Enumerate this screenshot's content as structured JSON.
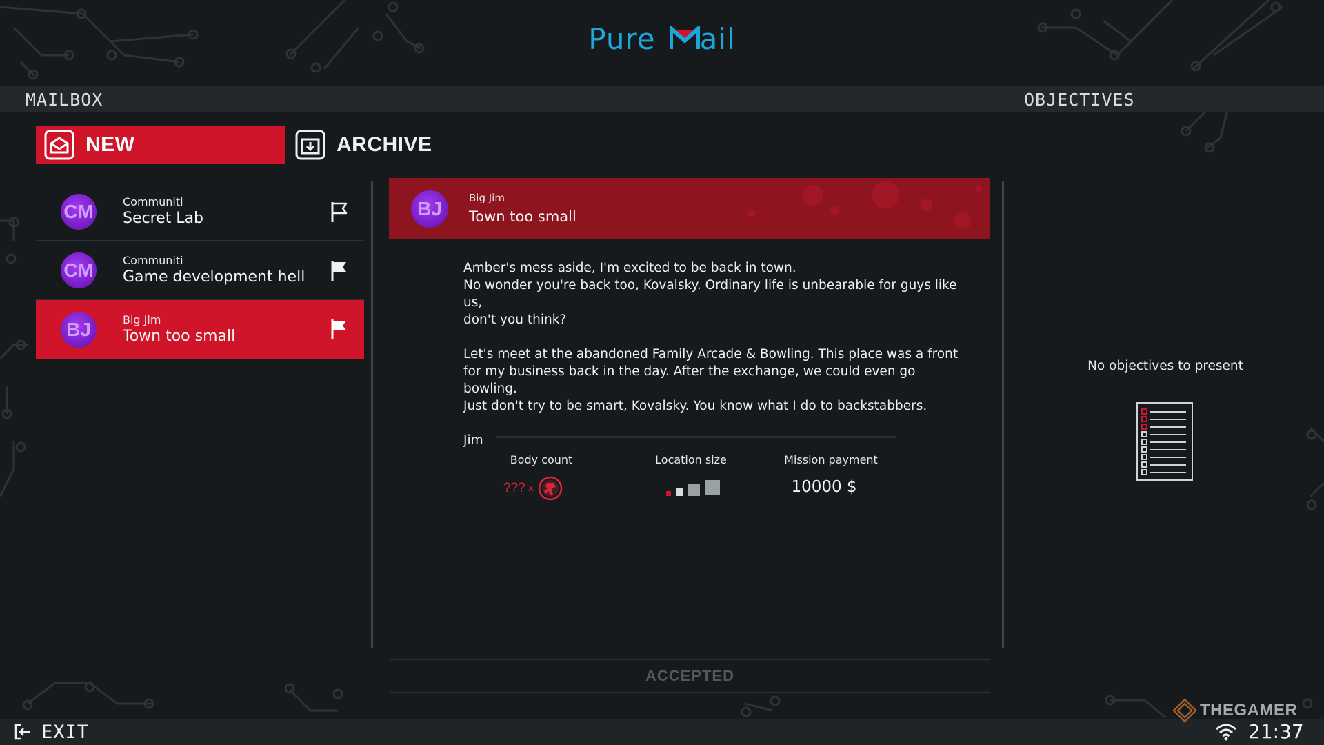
{
  "app": {
    "logo_part1": "Pure",
    "logo_part2": "ail"
  },
  "topbar": {
    "mailbox_label": "MAILBOX",
    "objectives_label": "OBJECTIVES"
  },
  "tabs": {
    "new_label": "NEW",
    "archive_label": "ARCHIVE"
  },
  "mails": [
    {
      "initials": "CM",
      "sender": "Communiti",
      "subject": "Secret Lab",
      "flag": "outline"
    },
    {
      "initials": "CM",
      "sender": "Communiti",
      "subject": "Game development hell",
      "flag": "filled"
    },
    {
      "initials": "BJ",
      "sender": "Big Jim",
      "subject": "Town too small",
      "flag": "filled",
      "selected": true
    }
  ],
  "message": {
    "initials": "BJ",
    "sender": "Big Jim",
    "subject": "Town too small",
    "paragraph1_line1": "Amber's mess aside, I'm excited to be back in town.",
    "paragraph1_line2": "No wonder you're back too, Kovalsky. Ordinary life is unbearable for guys like us,",
    "paragraph1_line3": "don't you think?",
    "paragraph2_line1": "Let's meet at the abandoned Family Arcade & Bowling. This place was a front",
    "paragraph2_line2": "for my business back in the day. After the exchange, we could even go bowling.",
    "paragraph2_line3": "Just don't try to be smart, Kovalsky. You know what I do to backstabbers.",
    "signature": "Jim"
  },
  "stats": {
    "body_count_label": "Body count",
    "body_count_value": "???",
    "body_count_times": "x",
    "location_size_label": "Location size",
    "location_size_level": 1,
    "location_size_max": 3,
    "mission_payment_label": "Mission payment",
    "mission_payment_value": "10000 $"
  },
  "status_button": "ACCEPTED",
  "objectives": {
    "empty_text": "No objectives to present"
  },
  "bottombar": {
    "exit_label": "EXIT",
    "clock": "21:37"
  },
  "watermark": "THEGAMER",
  "colors": {
    "accent_red": "#d0152b",
    "logo_blue": "#1da6d9",
    "avatar_purple": "#7b1fc9",
    "background": "#161a1d"
  }
}
